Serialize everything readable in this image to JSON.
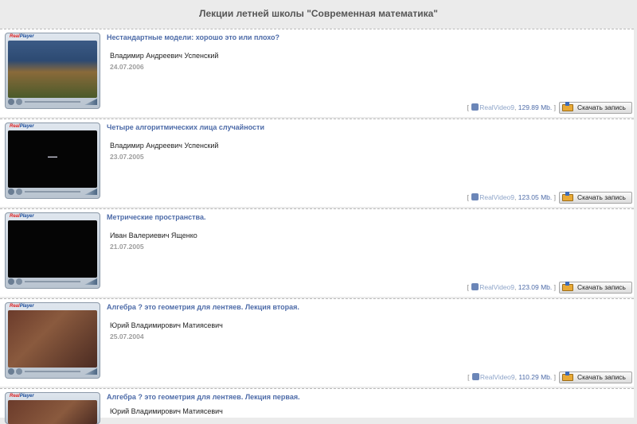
{
  "page": {
    "title": "Лекции летней школы \"Современная математика\""
  },
  "player": {
    "logo_real": "Real",
    "logo_player": "Player"
  },
  "lectures": [
    {
      "title": "Нестандартные модели: хорошо это или плохо?",
      "author": "Владимир Андреевич Успенский",
      "date": "24.07.2006",
      "format": "RealVideo9",
      "size": "129.89 Mb.",
      "download_label": "Скачать запись"
    },
    {
      "title": "Четыре алгоритмических лица случайности",
      "author": "Владимир Андреевич Успенский",
      "date": "23.07.2005",
      "format": "RealVideo9",
      "size": "123.05 Mb.",
      "download_label": "Скачать запись"
    },
    {
      "title": "Метрические пространства.",
      "author": "Иван Валериевич Ященко",
      "date": "21.07.2005",
      "format": "RealVideo9",
      "size": "123.09 Mb.",
      "download_label": "Скачать запись"
    },
    {
      "title": "Алгебра ? это геометрия для лентяев. Лекция вторая.",
      "author": "Юрий Владимирович Матиясевич",
      "date": "25.07.2004",
      "format": "RealVideo9",
      "size": "110.29 Mb.",
      "download_label": "Скачать запись"
    },
    {
      "title": "Алгебра ? это геометрия для лентяев. Лекция первая.",
      "author": "Юрий Владимирович Матиясевич",
      "date": "",
      "format": "",
      "size": "",
      "download_label": ""
    }
  ]
}
